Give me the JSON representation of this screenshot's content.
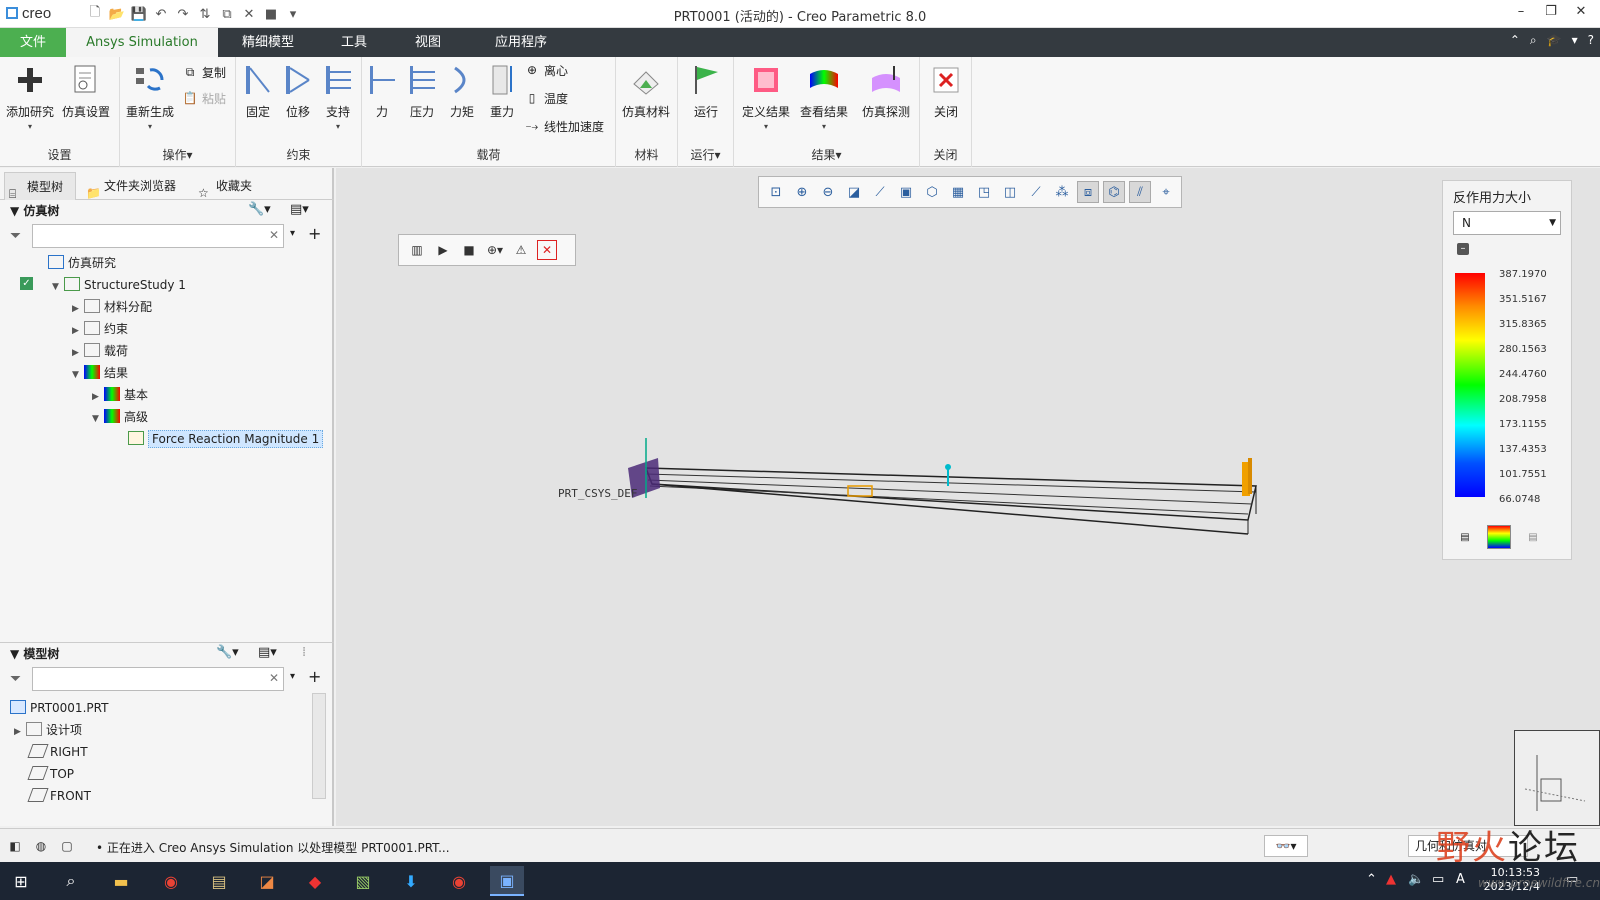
{
  "window": {
    "title": "PRT0001 (活动的) - Creo Parametric 8.0",
    "logo": "creo"
  },
  "tabs": [
    {
      "label": "文件"
    },
    {
      "label": "Ansys Simulation"
    },
    {
      "label": "精细模型"
    },
    {
      "label": "工具"
    },
    {
      "label": "视图"
    },
    {
      "label": "应用程序"
    }
  ],
  "ribbon": {
    "groups": {
      "setup": "设置",
      "ops": "操作",
      "constraints": "约束",
      "loads": "载荷",
      "material": "材料",
      "run": "运行",
      "results": "结果",
      "close": "关闭"
    },
    "buttons": {
      "add_study": "添加研究",
      "sim_setup": "仿真设置",
      "regenerate": "重新生成",
      "copy": "复制",
      "paste": "粘贴",
      "fixed": "固定",
      "displacement": "位移",
      "support": "支持",
      "force": "力",
      "pressure": "压力",
      "moment": "力矩",
      "gravity": "重力",
      "centrifugal": "离心",
      "temperature": "温度",
      "linear_accel": "线性加速度",
      "sim_material": "仿真材料",
      "run": "运行",
      "define_results": "定义结果",
      "view_results": "查看结果",
      "sim_probe": "仿真探测",
      "close": "关闭"
    }
  },
  "panel_tabs": [
    "模型树",
    "文件夹浏览器",
    "收藏夹"
  ],
  "sim_tree": {
    "header": "仿真树",
    "items": [
      {
        "label": "仿真研究"
      },
      {
        "label": "StructureStudy 1"
      },
      {
        "label": "材料分配"
      },
      {
        "label": "约束"
      },
      {
        "label": "载荷"
      },
      {
        "label": "结果"
      },
      {
        "label": "基本"
      },
      {
        "label": "高级"
      },
      {
        "label": "Force Reaction Magnitude 1"
      }
    ]
  },
  "model_tree": {
    "header": "模型树",
    "items": [
      {
        "label": "PRT0001.PRT"
      },
      {
        "label": "设计项"
      },
      {
        "label": "RIGHT"
      },
      {
        "label": "TOP"
      },
      {
        "label": "FRONT"
      }
    ]
  },
  "viewport": {
    "csys_label": "PRT_CSYS_DEF"
  },
  "legend": {
    "title": "反作用力大小",
    "unit": "N",
    "values": [
      "387.1970",
      "351.5167",
      "315.8365",
      "280.1563",
      "244.4760",
      "208.7958",
      "173.1155",
      "137.4353",
      "101.7551",
      "66.0748"
    ]
  },
  "status": {
    "message": "• 正在进入 Creo Ansys Simulation 以处理模型 PRT0001.PRT...",
    "right_field": "几何和仿真对"
  },
  "taskbar": {
    "time": "10:13:53",
    "date": "2023/12/4"
  },
  "watermark": {
    "text1": "野火",
    "text2": "论坛",
    "url": "www.proewildfire.cn"
  },
  "colors": {
    "accent_green": "#4caf50",
    "tab_dark": "#343a40",
    "viewport_bg": "#e3e3e3"
  }
}
